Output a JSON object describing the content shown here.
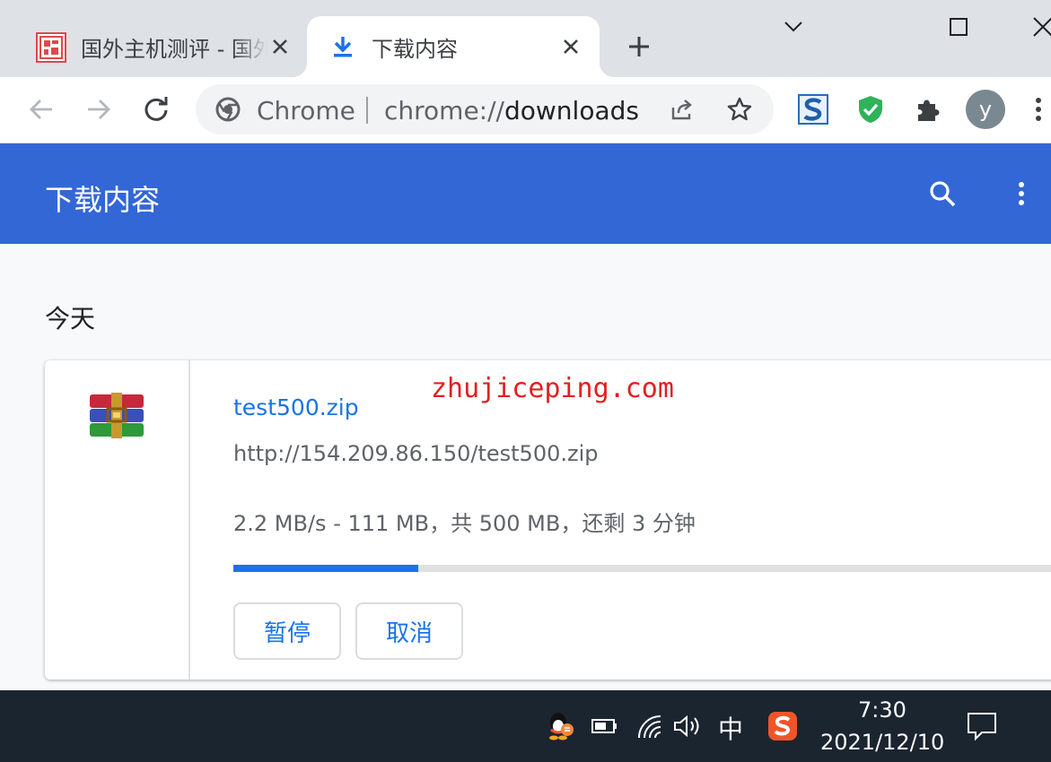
{
  "tabs": [
    {
      "title": "国外主机测评 - 国外",
      "favicon": "site-seal-icon",
      "close": "close-icon"
    },
    {
      "title": "下载内容",
      "favicon": "download-icon",
      "close": "close-icon",
      "active": true
    }
  ],
  "new_tab": "plus-icon",
  "window_controls": [
    "chevron-down-icon",
    "maximize-icon",
    "close-icon"
  ],
  "toolbar": {
    "back": "back-arrow-icon",
    "forward": "forward-arrow-icon",
    "reload": "reload-icon",
    "omnibox": {
      "scheme_label": "Chrome",
      "url_scheme": "chrome://",
      "url_host": "downloads",
      "share": "share-icon",
      "bookmark": "star-icon"
    },
    "extensions": [
      "s-extension-icon",
      "shield-check-icon",
      "puzzle-icon"
    ],
    "avatar_letter": "y",
    "menu": "kebab-menu-icon"
  },
  "downloads_page": {
    "title": "下载内容",
    "date_group": "今天",
    "item": {
      "file_name": "test500.zip",
      "url": "http://154.209.86.150/test500.zip",
      "status": "2.2 MB/s - 111 MB，共 500 MB，还剩 3 分钟",
      "progress": 0.222,
      "pause_label": "暂停",
      "cancel_label": "取消",
      "icon": "winrar-archive-icon"
    }
  },
  "watermark": "zhujiceping.com",
  "taskbar": {
    "ime": "中",
    "time": "7:30",
    "date": "2021/12/10",
    "tray_icons": [
      "qq-icon",
      "battery-icon",
      "wifi-icon",
      "volume-icon",
      "sogou-icon",
      "notification-icon"
    ]
  },
  "colors": {
    "header_blue": "#3367d6",
    "link_blue": "#1a73e8",
    "watermark_red": "#e02020"
  }
}
